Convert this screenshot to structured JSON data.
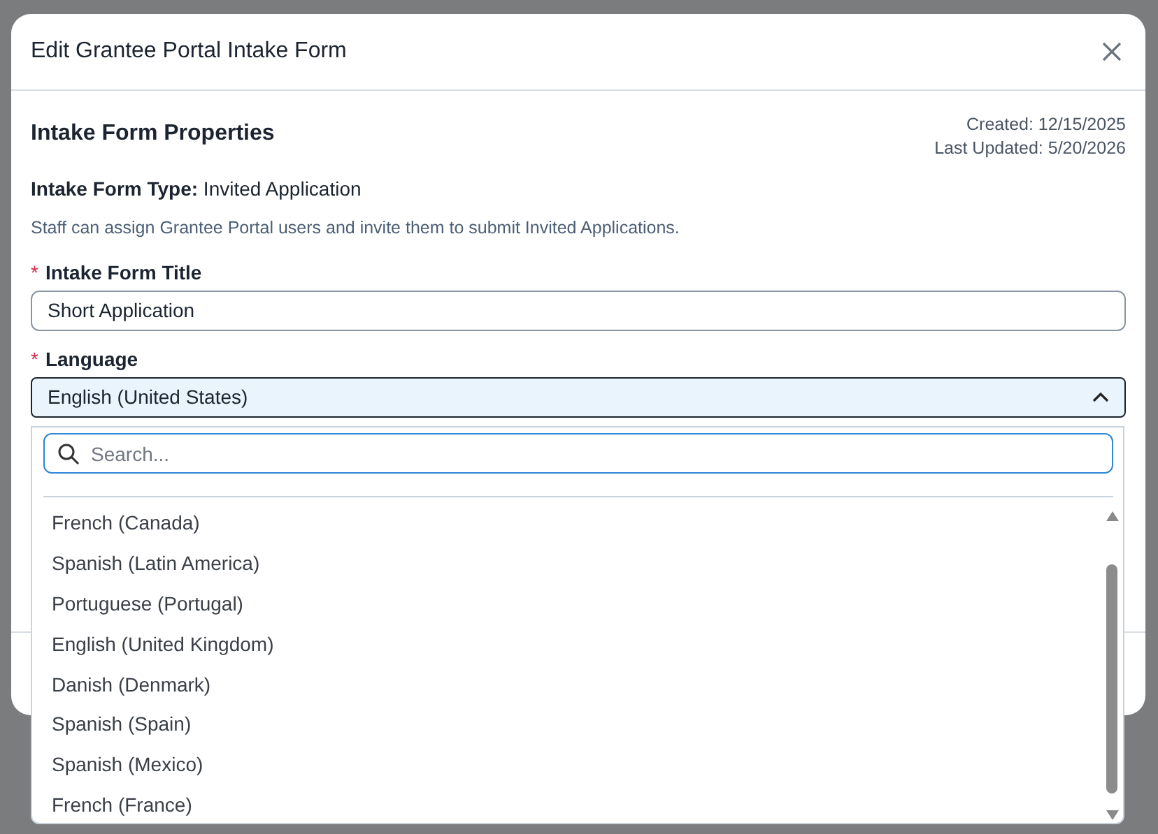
{
  "dialog": {
    "title": "Edit Grantee Portal Intake Form",
    "section_title": "Intake Form Properties",
    "created": "Created: 12/15/2025",
    "last_updated": "Last Updated: 5/20/2026",
    "form_type": "**Intake Form Type:** Invited Application",
    "description": "Staff can assign Grantee Portal users and invite them to submit Invited Applications.",
    "fields": [
      {
        "kind": "text",
        "label": "Intake Form Title",
        "required_mark": "*",
        "value": "Short Application"
      },
      {
        "kind": "select",
        "label": "Language",
        "required_mark": "*",
        "value": "English (United States)",
        "expanded": true
      }
    ]
  },
  "dropdown": {
    "search": {
      "placeholder": "Search..."
    },
    "options": [
      {
        "label": "French (Canada)",
        "selected": false
      },
      {
        "label": "Spanish (Latin America)",
        "selected": false
      },
      {
        "label": "Portuguese (Portugal)",
        "selected": false
      },
      {
        "label": "English (United Kingdom)",
        "selected": false
      },
      {
        "label": "Danish (Denmark)",
        "selected": false
      },
      {
        "label": "Spanish (Spain)",
        "selected": false
      },
      {
        "label": "Spanish (Mexico)",
        "selected": false
      },
      {
        "label": "French (France)",
        "selected": false
      }
    ]
  }
}
